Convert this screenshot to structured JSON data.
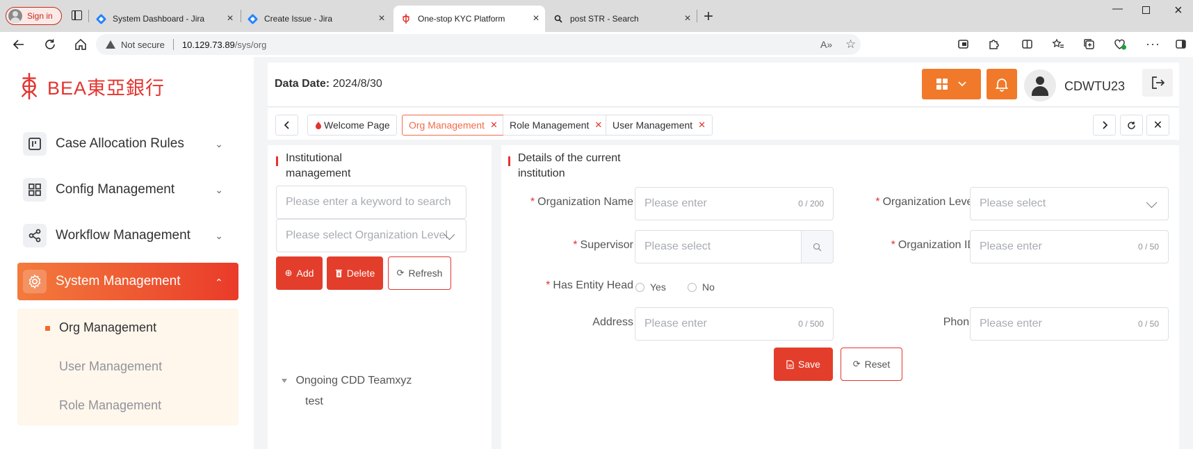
{
  "browser": {
    "signin_label": "Sign in",
    "tabs": [
      {
        "title": "System Dashboard - Jira",
        "icon": "jira-icon"
      },
      {
        "title": "Create Issue - Jira",
        "icon": "jira-icon"
      },
      {
        "title": "One-stop KYC Platform",
        "icon": "bea-icon",
        "active": true
      },
      {
        "title": "post STR - Search",
        "icon": "search-icon"
      }
    ],
    "url_security": "Not secure",
    "url_host": "10.129.73.89",
    "url_path": "/sys/org"
  },
  "colors": {
    "brand": "#e3342f",
    "accent_orange": "#f07a2a",
    "active_gradient_start": "#f37b3c",
    "active_gradient_end": "#ea3b2a"
  },
  "sidebar": {
    "logo_text": "BEA東亞銀行",
    "items": [
      {
        "label": "Case Allocation Rules",
        "icon": "kanban-icon"
      },
      {
        "label": "Config Management",
        "icon": "grid-icon"
      },
      {
        "label": "Workflow Management",
        "icon": "share-icon"
      },
      {
        "label": "System Management",
        "icon": "gear-icon",
        "active": true
      }
    ],
    "subitems": [
      {
        "label": "Org Management",
        "active": true
      },
      {
        "label": "User Management"
      },
      {
        "label": "Role Management"
      }
    ]
  },
  "header": {
    "data_date_label": "Data Date:",
    "data_date_value": "2024/8/30",
    "username": "CDWTU23"
  },
  "tags": [
    {
      "label": "Welcome Page",
      "icon": "home-icon"
    },
    {
      "label": "Org Management",
      "active": true
    },
    {
      "label": "Role Management"
    },
    {
      "label": "User Management"
    }
  ],
  "left_panel": {
    "title_line1": "Institutional",
    "title_line2": "management",
    "search_placeholder": "Please enter a keyword to search",
    "level_placeholder": "Please select Organization Level",
    "add_label": "Add",
    "delete_label": "Delete",
    "refresh_label": "Refresh",
    "tree": [
      {
        "label": "Ongoing CDD Teamxyz",
        "children": [
          {
            "label": "test"
          }
        ]
      }
    ]
  },
  "right_panel": {
    "title_line1": "Details of the current",
    "title_line2": "institution",
    "fields": {
      "org_name": {
        "label": "Organization Name",
        "placeholder": "Please enter",
        "count": "0 / 200"
      },
      "org_level": {
        "label": "Organization Level",
        "placeholder": "Please select"
      },
      "supervisor": {
        "label": "Supervisor",
        "placeholder": "Please select"
      },
      "org_id": {
        "label": "Organization ID",
        "placeholder": "Please enter",
        "count": "0 / 50"
      },
      "entity_head": {
        "label": "Has Entity Head",
        "options": [
          "Yes",
          "No"
        ]
      },
      "address": {
        "label": "Address",
        "placeholder": "Please enter",
        "count": "0 / 500"
      },
      "phone": {
        "label": "Phone",
        "placeholder": "Please enter",
        "count": "0 / 50"
      }
    },
    "save_label": "Save",
    "reset_label": "Reset"
  }
}
